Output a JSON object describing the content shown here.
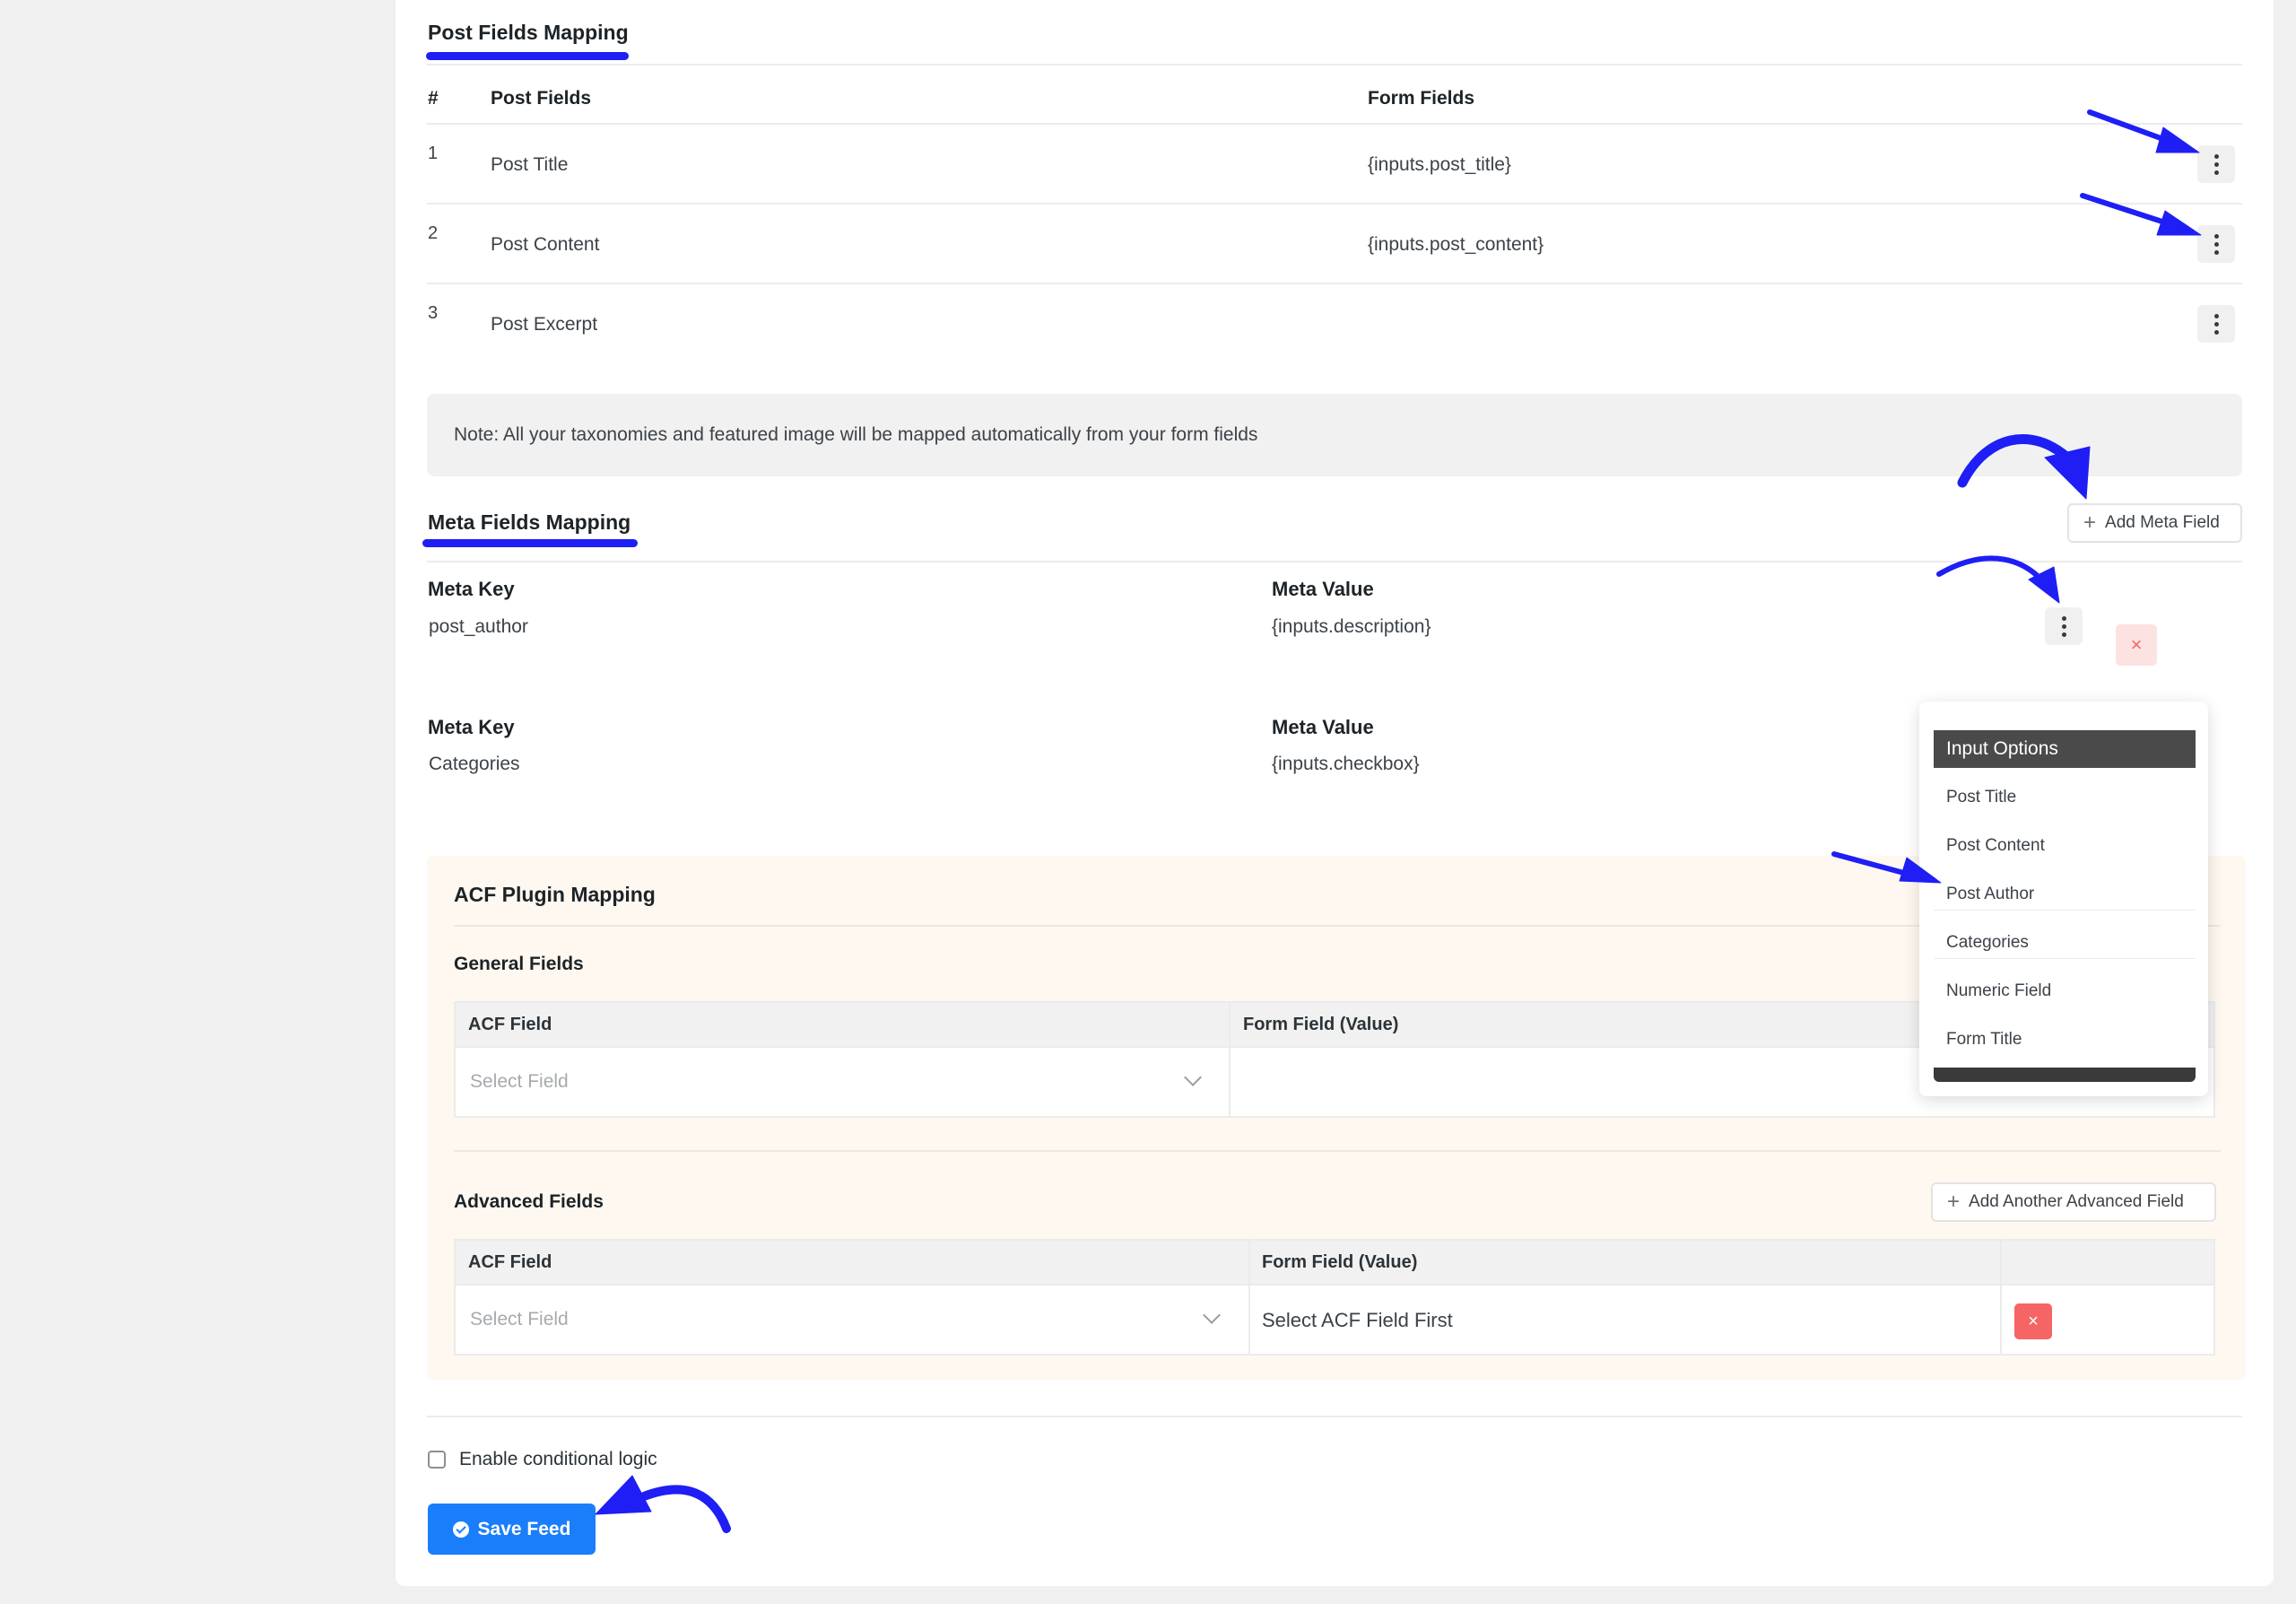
{
  "post_fields": {
    "title": "Post Fields Mapping",
    "headers": {
      "num": "#",
      "post_fields": "Post Fields",
      "form_fields": "Form Fields"
    },
    "rows": [
      {
        "num": "1",
        "post_field": "Post Title",
        "form_field": "{inputs.post_title}"
      },
      {
        "num": "2",
        "post_field": "Post Content",
        "form_field": "{inputs.post_content}"
      },
      {
        "num": "3",
        "post_field": "Post Excerpt",
        "form_field": ""
      }
    ]
  },
  "note": "Note: All your taxonomies and featured image will be mapped automatically from your form fields",
  "meta_fields": {
    "title": "Meta Fields Mapping",
    "add_button": "Add Meta Field",
    "key_label": "Meta Key",
    "value_label": "Meta Value",
    "rows": [
      {
        "key": "post_author",
        "value": "{inputs.description}"
      },
      {
        "key": "Categories",
        "value": "{inputs.checkbox}"
      }
    ]
  },
  "input_options": {
    "title": "Input Options",
    "items": [
      "Post Title",
      "Post Content",
      "Post Author",
      "Categories",
      "Numeric Field",
      "Form Title"
    ]
  },
  "acf": {
    "title": "ACF Plugin Mapping",
    "general": {
      "title": "General Fields",
      "col_acf": "ACF Field",
      "col_form": "Form Field (Value)",
      "select_placeholder": "Select Field"
    },
    "advanced": {
      "title": "Advanced Fields",
      "add_button": "Add Another Advanced Field",
      "col_acf": "ACF Field",
      "col_form": "Form Field (Value)",
      "select_placeholder": "Select Field",
      "form_value": "Select ACF Field First"
    }
  },
  "conditional_logic_label": "Enable conditional logic",
  "save_button": "Save Feed",
  "colors": {
    "accent": "#1a7efb",
    "annotation": "#1e1ef5",
    "danger": "#f56565",
    "acf_bg": "#fef8f1"
  }
}
